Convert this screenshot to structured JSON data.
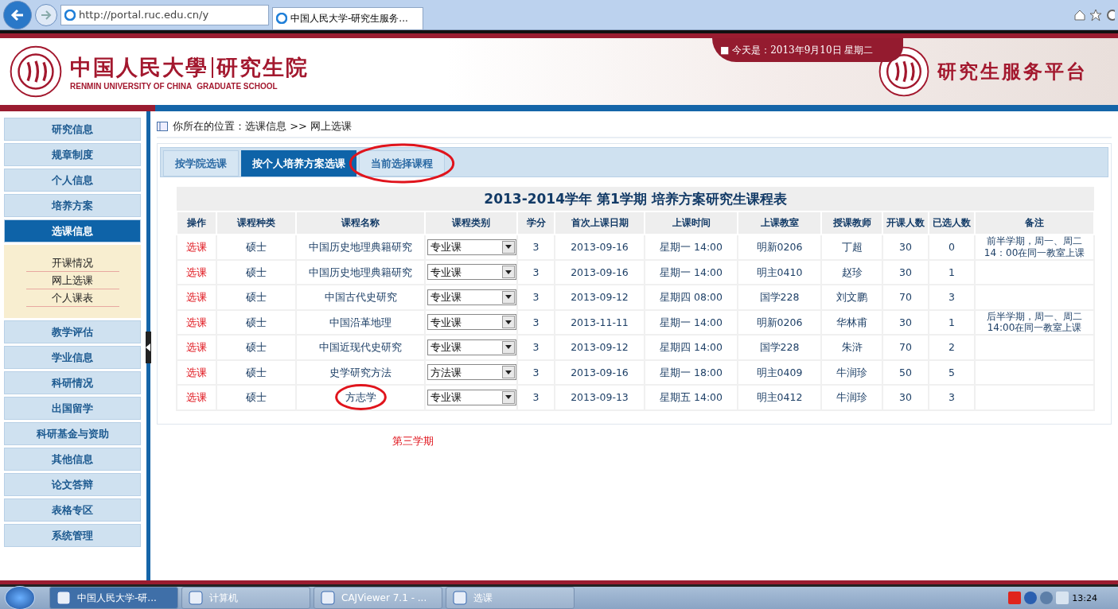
{
  "browser": {
    "address": "http://portal.ruc.edu.cn/y",
    "tab_title": "中国人民大学-研究生服务..."
  },
  "header": {
    "school_cn": "中国人民大學",
    "dept_cn": "研究生院",
    "school_en": "RENMIN UNIVERSITY OF CHINA",
    "dept_en": "GRADUATE SCHOOL",
    "date": "■ 今天是：2013年9月10日  星期二",
    "platform": "研究生服务平台"
  },
  "sidebar": {
    "items": [
      {
        "label": "研究信息",
        "selected": false
      },
      {
        "label": "规章制度",
        "selected": false
      },
      {
        "label": "个人信息",
        "selected": false
      },
      {
        "label": "培养方案",
        "selected": false
      },
      {
        "label": "选课信息",
        "selected": true,
        "children": [
          {
            "label": "开课情况"
          },
          {
            "label": "网上选课"
          },
          {
            "label": "个人课表"
          }
        ]
      },
      {
        "label": "教学评估",
        "selected": false
      },
      {
        "label": "学业信息",
        "selected": false
      },
      {
        "label": "科研情况",
        "selected": false
      },
      {
        "label": "出国留学",
        "selected": false
      },
      {
        "label": "科研基金与资助",
        "selected": false
      },
      {
        "label": "其他信息",
        "selected": false
      },
      {
        "label": "论文答辩",
        "selected": false
      },
      {
        "label": "表格专区",
        "selected": false
      },
      {
        "label": "系统管理",
        "selected": false
      }
    ]
  },
  "breadcrumb": "你所在的位置：选课信息 >> 网上选课",
  "tabs": [
    {
      "label": "按学院选课",
      "selected": false,
      "circled": false
    },
    {
      "label": "按个人培养方案选课",
      "selected": true,
      "circled": false
    },
    {
      "label": "当前选择课程",
      "selected": false,
      "circled": true
    }
  ],
  "table": {
    "title": "2013-2014学年 第1学期 培养方案研究生课程表",
    "columns": [
      "操作",
      "课程种类",
      "课程名称",
      "课程类别",
      "学分",
      "首次上课日期",
      "上课时间",
      "上课教室",
      "授课教师",
      "开课人数",
      "已选人数",
      "备注"
    ],
    "rows": [
      {
        "action": "选课",
        "level_type": "硕士",
        "name": "中国历史地理典籍研究",
        "circled": false,
        "category": "专业课",
        "credit": "3",
        "first_date": "2013-09-16",
        "time": "星期一 14:00",
        "room": "明新0206",
        "teacher": "丁超",
        "capacity": "30",
        "enrolled": "0",
        "note": "前半学期，周一、周二14：00在同一教室上课"
      },
      {
        "action": "选课",
        "level_type": "硕士",
        "name": "中国历史地理典籍研究",
        "circled": false,
        "category": "专业课",
        "credit": "3",
        "first_date": "2013-09-16",
        "time": "星期一 14:00",
        "room": "明主0410",
        "teacher": "赵珍",
        "capacity": "30",
        "enrolled": "1"
      },
      {
        "action": "选课",
        "level_type": "硕士",
        "name": "中国古代史研究",
        "circled": false,
        "category": "专业课",
        "credit": "3",
        "first_date": "2013-09-12",
        "time": "星期四 08:00",
        "room": "国学228",
        "teacher": "刘文鹏",
        "capacity": "70",
        "enrolled": "3"
      },
      {
        "action": "选课",
        "level_type": "硕士",
        "name": "中国沿革地理",
        "circled": false,
        "category": "专业课",
        "credit": "3",
        "first_date": "2013-11-11",
        "time": "星期一 14:00",
        "room": "明新0206",
        "teacher": "华林甫",
        "capacity": "30",
        "enrolled": "1",
        "note": "后半学期，周一、周二14:00在同一教室上课"
      },
      {
        "action": "选课",
        "level_type": "硕士",
        "name": "中国近现代史研究",
        "circled": false,
        "category": "专业课",
        "credit": "3",
        "first_date": "2013-09-12",
        "time": "星期四 14:00",
        "room": "国学228",
        "teacher": "朱浒",
        "capacity": "70",
        "enrolled": "2"
      },
      {
        "action": "选课",
        "level_type": "硕士",
        "name": "史学研究方法",
        "circled": false,
        "category": "方法课",
        "credit": "3",
        "first_date": "2013-09-16",
        "time": "星期一 18:00",
        "room": "明主0409",
        "teacher": "牛润珍",
        "capacity": "50",
        "enrolled": "5"
      },
      {
        "action": "选课",
        "level_type": "硕士",
        "name": "方志学",
        "circled": true,
        "category": "专业课",
        "credit": "3",
        "first_date": "2013-09-13",
        "time": "星期五 14:00",
        "room": "明主0412",
        "teacher": "牛润珍",
        "capacity": "30",
        "enrolled": "3"
      }
    ]
  },
  "handwritten_note": "第三学期",
  "taskbar": {
    "items": [
      {
        "label": "中国人民大学-研...",
        "selected": true
      },
      {
        "label": "计算机",
        "selected": false
      },
      {
        "label": "CAJViewer 7.1 - ...",
        "selected": false
      },
      {
        "label": "选课",
        "selected": false
      }
    ],
    "clock": "13:24"
  }
}
